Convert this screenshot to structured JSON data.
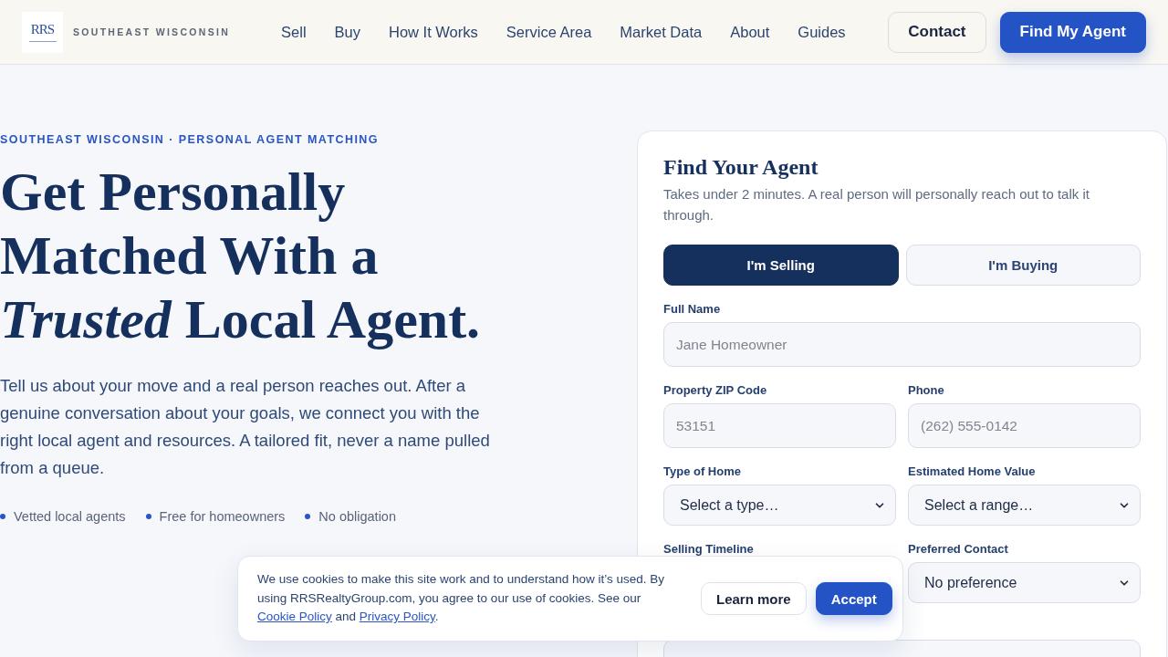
{
  "header": {
    "logo_text": "RRS",
    "region": "SOUTHEAST WISCONSIN",
    "nav": [
      "Sell",
      "Buy",
      "How It Works",
      "Service Area",
      "Market Data",
      "About",
      "Guides"
    ],
    "buttons": [
      {
        "label": "Contact",
        "kind": "secondary"
      },
      {
        "label": "Find My Agent",
        "kind": "primary"
      }
    ]
  },
  "hero": {
    "eyebrow": "SOUTHEAST WISCONSIN · PERSONAL AGENT MATCHING",
    "heading": "Get Personally Matched With a *Trusted* Local Agent.",
    "intro": "Tell us about your move and a real person reaches out. After a genuine conversation about your goals, we connect you with the right local agent and resources. A tailored fit, never a name pulled from a queue.",
    "highlights": [
      "Vetted local agents",
      "Free for homeowners",
      "No obligation"
    ]
  },
  "form": {
    "title": "Find Your Agent",
    "subtitle": "Takes under 2 minutes. A real person will personally reach out to talk it through.",
    "modes": [
      {
        "label": "I'm Selling",
        "selected": true
      },
      {
        "label": "I'm Buying",
        "selected": false
      }
    ],
    "rows": [
      [
        {
          "label": "Full Name",
          "kind": "input",
          "placeholder": "Jane Homeowner"
        }
      ],
      [
        {
          "label": "Property ZIP Code",
          "kind": "input",
          "placeholder": "53151"
        },
        {
          "label": "Phone",
          "kind": "input",
          "placeholder": "(262) 555-0142"
        }
      ],
      [
        {
          "label": "Type of Home",
          "kind": "select",
          "value": "Select a type…"
        },
        {
          "label": "Estimated Home Value",
          "kind": "select",
          "value": "Select a range…"
        }
      ],
      [
        {
          "label": "Selling Timeline"
        },
        {
          "label": "Preferred Contact",
          "kind": "select",
          "value": "No preference"
        }
      ],
      [
        {
          "kind": "input"
        }
      ]
    ]
  },
  "cookie_banner": {
    "segments": [
      {
        "kind": "text",
        "text": "We use cookies to make this site work and to understand how it’s used. By using RRSRealtyGroup.com, you agree to our use of cookies. See our "
      },
      {
        "kind": "link",
        "text": "Cookie Policy"
      },
      {
        "kind": "text",
        "text": " and "
      },
      {
        "kind": "link",
        "text": "Privacy Policy"
      },
      {
        "kind": "text",
        "text": "."
      }
    ],
    "buttons": [
      {
        "label": "Learn more",
        "kind": "secondary"
      },
      {
        "label": "Accept",
        "kind": "primary"
      }
    ]
  }
}
